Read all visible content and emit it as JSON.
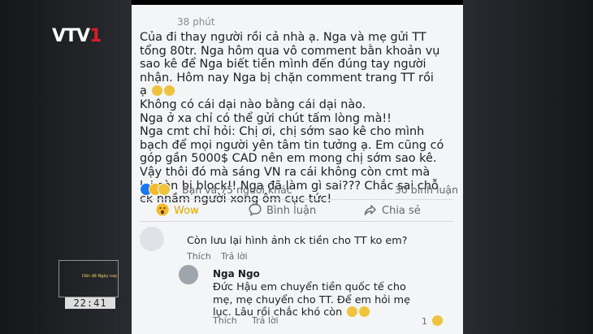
{
  "broadcast": {
    "logo_text_vtv": "VTV",
    "logo_text_num": "1",
    "clock": "22:41",
    "mini_badge": "Dân đề Ngày nay"
  },
  "post": {
    "timestamp": "38 phút",
    "lines": [
      "Của đi thay người rồi cả nhà ạ. Nga và mẹ gửi TT",
      "tổng 80tr. Nga hôm qua vô comment bằn khoản vụ",
      "sao kê để Nga biết tiền mình đến đúng tay người",
      "nhận. Hôm nay Nga bị chặn comment trang TT rồi",
      "ạ",
      "Không có cái dại nào bằng cái dại nào.",
      "Nga ở xa chỉ có thể gửi chút tấm lòng mà!!",
      "Nga cmt chỉ hỏi: Chị ơi, chị sớm sao kê cho mình",
      "bạch để mọi người yên tâm tin tưởng ạ. Em cũng có",
      "góp gần 5000$ CAD nên em mong chị sớm sao kê.",
      "Vậy thôi đó mà sáng VN ra cái không còn cmt mà",
      "lại còn bị block!! Nga đã làm gì sai??? Chắc sai chỗ",
      "ck nhầm người xong ôm cục tức!"
    ],
    "reactions_text": "Bạn và 75 người khác",
    "comments_count": "30 bình luận",
    "actions": {
      "wow": "Wow",
      "comment": "Bình luận",
      "share": "Chia sẻ"
    }
  },
  "comments": [
    {
      "text": "Còn lưu lại hình ảnh ck tiền cho TT ko em?",
      "like": "Thích",
      "reply": "Trả lời"
    },
    {
      "name": "Nga Ngo",
      "lines": [
        "Đức Hậu em chuyển tiền quốc tế cho",
        "mẹ, mẹ chuyển cho TT. Để em hỏi mẹ",
        "lục. Lâu rồi chắc khó còn"
      ],
      "like": "Thích",
      "reply": "Trả lời",
      "like_count": "1"
    }
  ],
  "colors": {
    "accent": "#1877f2",
    "wow": "#f7b928",
    "vtv_red": "#e21b23"
  }
}
